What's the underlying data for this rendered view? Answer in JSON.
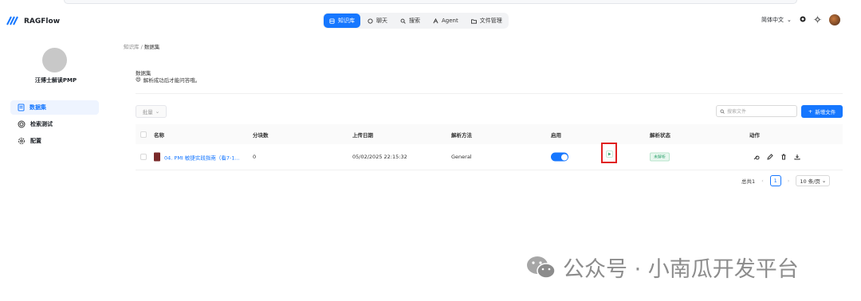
{
  "header": {
    "brand": "RAGFlow",
    "nav": [
      {
        "label": "知识库",
        "icon": "database-icon",
        "active": true
      },
      {
        "label": "聊天",
        "icon": "chat-icon",
        "active": false
      },
      {
        "label": "搜索",
        "icon": "search-icon",
        "active": false
      },
      {
        "label": "Agent",
        "icon": "agent-icon",
        "active": false
      },
      {
        "label": "文件管理",
        "icon": "folder-icon",
        "active": false
      }
    ],
    "language": "简体中文"
  },
  "sidebar": {
    "name": "汪博士解读PMP",
    "items": [
      {
        "label": "数据集",
        "icon": "file-text-icon",
        "active": true
      },
      {
        "label": "检索测试",
        "icon": "target-icon",
        "active": false
      },
      {
        "label": "配置",
        "icon": "gear-icon",
        "active": false
      }
    ]
  },
  "breadcrumb": {
    "root": "知识库",
    "sep": "/",
    "current": "数据集"
  },
  "section": {
    "title": "数据集",
    "desc": "解析成功后才能问答哦。"
  },
  "toolbar": {
    "bulk_label": "批量",
    "search_placeholder": "搜索文件",
    "add_label": "新增文件"
  },
  "table": {
    "headers": [
      "名称",
      "分块数",
      "上传日期",
      "解析方法",
      "启用",
      "解析状态",
      "动作"
    ],
    "rows": [
      {
        "name": "04. PMI 敏捷实践指南（看7-1...",
        "chunks": "0",
        "date": "05/02/2025 22:15:32",
        "method": "General",
        "enabled": true,
        "status": "未解析"
      }
    ]
  },
  "pagination": {
    "total": "总共1",
    "page": "1",
    "page_size": "10 条/页"
  },
  "watermark": "公众号 · 小南瓜开发平台",
  "colors": {
    "accent": "#1677ff",
    "highlight": "#e02020"
  }
}
